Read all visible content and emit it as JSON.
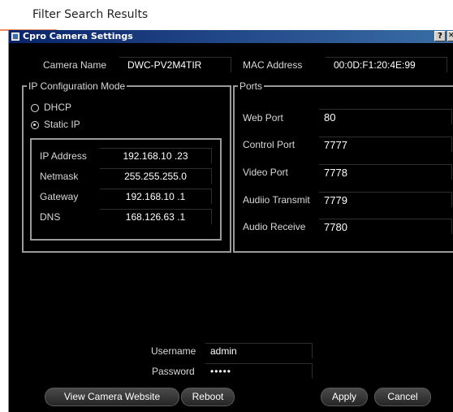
{
  "page": {
    "heading": "Filter Search Results"
  },
  "window": {
    "title": "Cpro Camera Settings",
    "help_label": "?",
    "close_label": "✕"
  },
  "camera": {
    "name_label": "Camera Name",
    "name_value": "DWC-PV2M4TIR",
    "mac_label": "MAC Address",
    "mac_value": "00:0D:F1:20:4E:99"
  },
  "ip_config": {
    "legend": "IP Configuration Mode",
    "modes": [
      {
        "label": "DHCP",
        "selected": false
      },
      {
        "label": "Static IP",
        "selected": true
      }
    ],
    "fields": [
      {
        "label": "IP Address",
        "value": "192.168.10 .23"
      },
      {
        "label": "Netmask",
        "value": "255.255.255.0"
      },
      {
        "label": "Gateway",
        "value": "192.168.10 .1"
      },
      {
        "label": "DNS",
        "value": "168.126.63 .1"
      }
    ]
  },
  "ports": {
    "legend": "Ports",
    "fields": [
      {
        "label": "Web Port",
        "value": "80"
      },
      {
        "label": "Control Port",
        "value": "7777"
      },
      {
        "label": "Video Port",
        "value": "7778"
      },
      {
        "label": "Audiio Transmit",
        "value": "7779"
      },
      {
        "label": "Audio Receive",
        "value": "7780"
      }
    ]
  },
  "credentials": {
    "username_label": "Username",
    "username_value": "admin",
    "password_label": "Password",
    "password_value": "•••••"
  },
  "buttons": {
    "view_website": "View Camera Website",
    "reboot": "Reboot",
    "apply": "Apply",
    "cancel": "Cancel"
  },
  "icons": {
    "window_icon": "window-icon",
    "help": "help-icon",
    "close": "close-icon"
  }
}
